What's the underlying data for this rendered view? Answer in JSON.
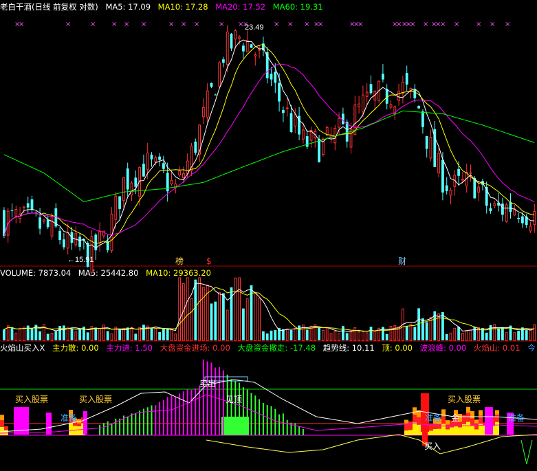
{
  "colors": {
    "background": "#000000",
    "up_candle": "#ff3232",
    "down_candle": "#54ffff",
    "ma5": "#ffffff",
    "ma10": "#ffff00",
    "ma20": "#ff00ff",
    "ma60": "#00ff00",
    "separator": "#b00000",
    "volume_up": "#ff3232",
    "volume_down": "#54ffff"
  },
  "price_panel": {
    "title": "老白干酒(日线 前复权 对数)",
    "ma_labels": [
      {
        "text": "MA5: 17.09",
        "color": "#ffffff"
      },
      {
        "text": "MA10: 17.28",
        "color": "#ffff00"
      },
      {
        "text": "MA20: 17.52",
        "color": "#ff00ff"
      },
      {
        "text": "MA60: 19.31",
        "color": "#00ff00"
      }
    ],
    "high_label": "23.49",
    "low_label": "←15.91",
    "event_markers": [
      {
        "text": "榜",
        "color": "#ffd24a"
      },
      {
        "text": "$",
        "color": "#ff3030"
      },
      {
        "text": "财",
        "color": "#7fd0ff"
      }
    ],
    "x_marker_glyph": "×"
  },
  "volume_panel": {
    "labels": [
      {
        "text": "VOLUME: 7873.04",
        "color": "#ffffff"
      },
      {
        "text": "MA5: 25442.80",
        "color": "#ffffff"
      },
      {
        "text": "MA10: 29363.20",
        "color": "#ffff00"
      }
    ]
  },
  "indicator_panel": {
    "labels": [
      {
        "text": "火焰山买入X",
        "color": "#ffffff"
      },
      {
        "text": "主力散: 0.00",
        "color": "#ffff00"
      },
      {
        "text": "主力进: 1.50",
        "color": "#ff00ff"
      },
      {
        "text": "大盘资金进场: 0.00",
        "color": "#ff3030"
      },
      {
        "text": "大盘资金撤走: -17.48",
        "color": "#00ff00"
      },
      {
        "text": "趋势线: 10.11",
        "color": "#ffffff"
      },
      {
        "text": "顶: 0.00",
        "color": "#ffff00"
      },
      {
        "text": "波浪峰: 0.00",
        "color": "#ff00ff"
      },
      {
        "text": "火焰山: 0.01",
        "color": "#ff3030"
      },
      {
        "text": "今",
        "color": "#3399ff"
      }
    ],
    "annotations": [
      {
        "text": "买入股票",
        "color": "#ffcc33"
      },
      {
        "text": "买入股票",
        "color": "#ffcc33"
      },
      {
        "text": "买入股票",
        "color": "#ffcc33"
      },
      {
        "text": "准备",
        "color": "#44aaff"
      },
      {
        "text": "准备",
        "color": "#44aaff"
      },
      {
        "text": "准备",
        "color": "#44aaff"
      },
      {
        "text": "卖出",
        "color": "#ffffff"
      },
      {
        "text": "见顶",
        "color": "#ffffff"
      },
      {
        "text": "买入",
        "color": "#ffffff"
      },
      {
        "text": "金",
        "color": "#ffffff"
      }
    ]
  },
  "chart_data": {
    "type": "candlestick",
    "scale": "log",
    "n_candles": 134,
    "price_extremes": {
      "high": 23.49,
      "low": 15.91
    },
    "close_path_anchors": [
      [
        0,
        16.9
      ],
      [
        6,
        16.8
      ],
      [
        13,
        16.5
      ],
      [
        16,
        16.1
      ],
      [
        22,
        15.9
      ],
      [
        26,
        16.4
      ],
      [
        30,
        18.0
      ],
      [
        35,
        18.6
      ],
      [
        39,
        18.3
      ],
      [
        43,
        17.8
      ],
      [
        47,
        18.9
      ],
      [
        52,
        21.0
      ],
      [
        55,
        22.6
      ],
      [
        59,
        23.2
      ],
      [
        62,
        22.9
      ],
      [
        66,
        21.8
      ],
      [
        70,
        20.5
      ],
      [
        75,
        19.3
      ],
      [
        80,
        19.2
      ],
      [
        85,
        19.7
      ],
      [
        90,
        20.6
      ],
      [
        95,
        21.0
      ],
      [
        100,
        21.2
      ],
      [
        104,
        20.5
      ],
      [
        108,
        18.6
      ],
      [
        112,
        17.8
      ],
      [
        118,
        18.0
      ],
      [
        122,
        17.1
      ],
      [
        128,
        17.3
      ],
      [
        133,
        17.0
      ]
    ],
    "ma60_path_anchors": [
      [
        0,
        18.9
      ],
      [
        10,
        18.3
      ],
      [
        20,
        17.4
      ],
      [
        30,
        17.7
      ],
      [
        40,
        17.8
      ],
      [
        50,
        18.0
      ],
      [
        60,
        18.5
      ],
      [
        70,
        19.0
      ],
      [
        80,
        19.4
      ],
      [
        90,
        19.8
      ],
      [
        100,
        20.4
      ],
      [
        110,
        20.3
      ],
      [
        120,
        19.9
      ],
      [
        133,
        19.3
      ]
    ]
  }
}
